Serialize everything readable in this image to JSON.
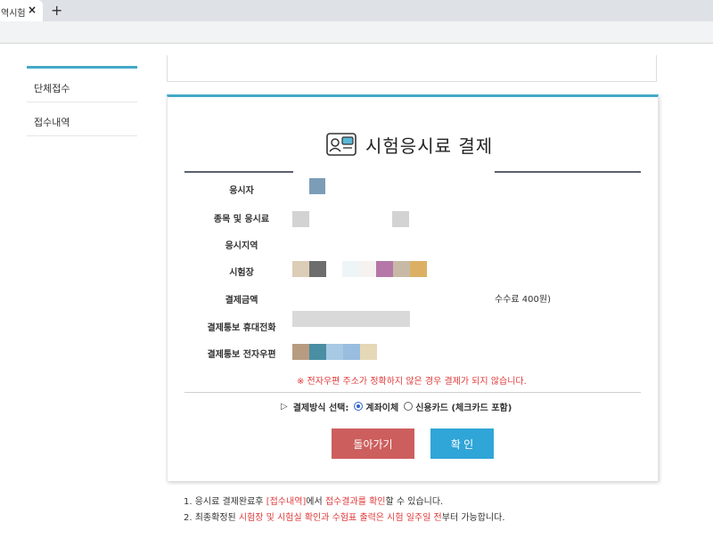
{
  "browser": {
    "tab_title": "역시험",
    "tab_close": "×",
    "new_tab": "+"
  },
  "sidebar": {
    "items": [
      {
        "label": "단체접수"
      },
      {
        "label": "접수내역"
      }
    ]
  },
  "card": {
    "title": "시험응시료 결제",
    "rows": [
      {
        "label": "응시자"
      },
      {
        "label": "종목 및 응시료"
      },
      {
        "label": "응시지역"
      },
      {
        "label": "시험장"
      },
      {
        "label": "결제금액"
      },
      {
        "label": "결제통보 휴대전화"
      },
      {
        "label": "결제통보 전자우편"
      }
    ],
    "fee_note": "수수료 400원)",
    "warning": "※ 전자우편 주소가 정확하지 않은 경우 결제가 되지 않습니다.",
    "payment": {
      "label": "결제방식 선택:",
      "options": [
        {
          "label": "계좌이체",
          "selected": true
        },
        {
          "label": "신용카드 (체크카드 포함)",
          "selected": false
        }
      ]
    },
    "buttons": {
      "back": "돌아가기",
      "confirm": "확 인"
    }
  },
  "notes": {
    "line1": {
      "a": "1. 응시료 결제완료후 ",
      "b": "[접수내역]",
      "c": "에서 ",
      "d": "접수결과를 확인",
      "e": "할 수 있습니다."
    },
    "line2": {
      "a": "2. 최종확정된 ",
      "b": "시험장 및 시험실 확인과 수험표 출력은 시험 일주일 전",
      "c": "부터 가능합니다."
    }
  },
  "colors": {
    "accent": "#44a9c8",
    "back_button": "#cd5e5e",
    "confirm_button": "#30a5d8",
    "warning": "#e03a3a"
  }
}
